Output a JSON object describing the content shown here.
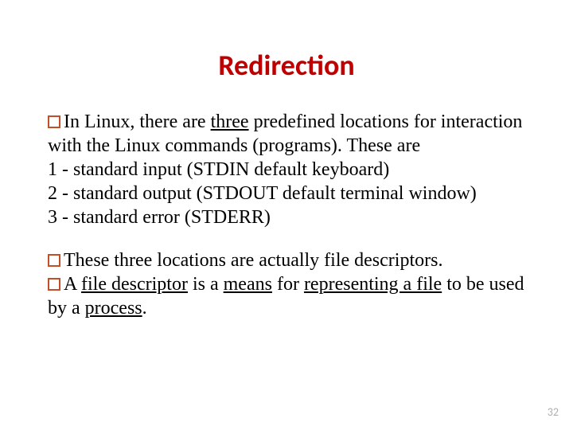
{
  "title": "Redirection",
  "p1": {
    "pre": "In Linux, there are ",
    "u": "three",
    "post": " predefined locations for interaction with the Linux commands (programs). These are",
    "l1": "1 - standard input (STDIN default keyboard)",
    "l2": "2 - standard output (STDOUT default terminal window)",
    "l3": "3 - standard error (STDERR)"
  },
  "p2": "These three locations are actually file descriptors.",
  "p3": {
    "a": "A ",
    "b": "file descriptor",
    "c": " is a ",
    "d": "means",
    "e": " for ",
    "f": "representing a file",
    "g": " to be used by a ",
    "h": "process",
    "i": "."
  },
  "pagenum": "32",
  "icons": {
    "bullet": "square-bullet-icon"
  }
}
